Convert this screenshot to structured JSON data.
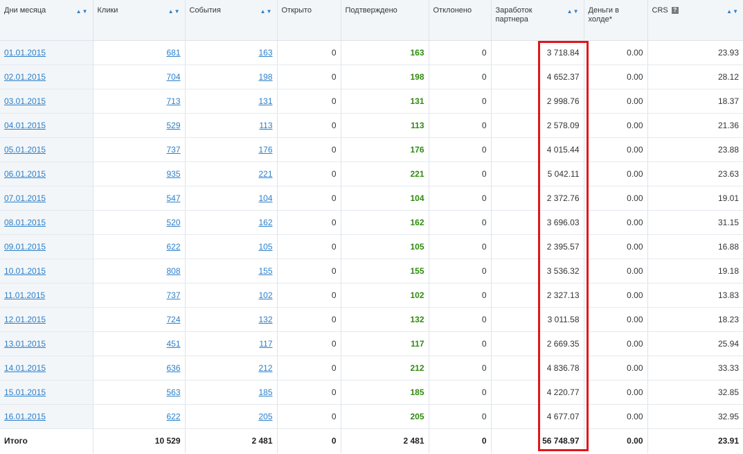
{
  "columns": [
    {
      "label": "Дни месяца",
      "sortable": true
    },
    {
      "label": "Клики",
      "sortable": true
    },
    {
      "label": "События",
      "sortable": true
    },
    {
      "label": "Открыто",
      "sortable": false
    },
    {
      "label": "Подтверждено",
      "sortable": false
    },
    {
      "label": "Отклонено",
      "sortable": false
    },
    {
      "label": "Заработок партнера",
      "sortable": true
    },
    {
      "label": "Деньги в холде*",
      "sortable": false
    },
    {
      "label": "CRS",
      "sortable": true,
      "help": "?"
    }
  ],
  "sort_glyph": "▲▼",
  "rows": [
    {
      "date": "01.01.2015",
      "clicks": "681",
      "events": "163",
      "open": "0",
      "confirmed": "163",
      "rejected": "0",
      "earnings": "3 718.84",
      "hold": "0.00",
      "crs": "23.93"
    },
    {
      "date": "02.01.2015",
      "clicks": "704",
      "events": "198",
      "open": "0",
      "confirmed": "198",
      "rejected": "0",
      "earnings": "4 652.37",
      "hold": "0.00",
      "crs": "28.12"
    },
    {
      "date": "03.01.2015",
      "clicks": "713",
      "events": "131",
      "open": "0",
      "confirmed": "131",
      "rejected": "0",
      "earnings": "2 998.76",
      "hold": "0.00",
      "crs": "18.37"
    },
    {
      "date": "04.01.2015",
      "clicks": "529",
      "events": "113",
      "open": "0",
      "confirmed": "113",
      "rejected": "0",
      "earnings": "2 578.09",
      "hold": "0.00",
      "crs": "21.36"
    },
    {
      "date": "05.01.2015",
      "clicks": "737",
      "events": "176",
      "open": "0",
      "confirmed": "176",
      "rejected": "0",
      "earnings": "4 015.44",
      "hold": "0.00",
      "crs": "23.88"
    },
    {
      "date": "06.01.2015",
      "clicks": "935",
      "events": "221",
      "open": "0",
      "confirmed": "221",
      "rejected": "0",
      "earnings": "5 042.11",
      "hold": "0.00",
      "crs": "23.63"
    },
    {
      "date": "07.01.2015",
      "clicks": "547",
      "events": "104",
      "open": "0",
      "confirmed": "104",
      "rejected": "0",
      "earnings": "2 372.76",
      "hold": "0.00",
      "crs": "19.01"
    },
    {
      "date": "08.01.2015",
      "clicks": "520",
      "events": "162",
      "open": "0",
      "confirmed": "162",
      "rejected": "0",
      "earnings": "3 696.03",
      "hold": "0.00",
      "crs": "31.15"
    },
    {
      "date": "09.01.2015",
      "clicks": "622",
      "events": "105",
      "open": "0",
      "confirmed": "105",
      "rejected": "0",
      "earnings": "2 395.57",
      "hold": "0.00",
      "crs": "16.88"
    },
    {
      "date": "10.01.2015",
      "clicks": "808",
      "events": "155",
      "open": "0",
      "confirmed": "155",
      "rejected": "0",
      "earnings": "3 536.32",
      "hold": "0.00",
      "crs": "19.18"
    },
    {
      "date": "11.01.2015",
      "clicks": "737",
      "events": "102",
      "open": "0",
      "confirmed": "102",
      "rejected": "0",
      "earnings": "2 327.13",
      "hold": "0.00",
      "crs": "13.83"
    },
    {
      "date": "12.01.2015",
      "clicks": "724",
      "events": "132",
      "open": "0",
      "confirmed": "132",
      "rejected": "0",
      "earnings": "3 011.58",
      "hold": "0.00",
      "crs": "18.23"
    },
    {
      "date": "13.01.2015",
      "clicks": "451",
      "events": "117",
      "open": "0",
      "confirmed": "117",
      "rejected": "0",
      "earnings": "2 669.35",
      "hold": "0.00",
      "crs": "25.94"
    },
    {
      "date": "14.01.2015",
      "clicks": "636",
      "events": "212",
      "open": "0",
      "confirmed": "212",
      "rejected": "0",
      "earnings": "4 836.78",
      "hold": "0.00",
      "crs": "33.33"
    },
    {
      "date": "15.01.2015",
      "clicks": "563",
      "events": "185",
      "open": "0",
      "confirmed": "185",
      "rejected": "0",
      "earnings": "4 220.77",
      "hold": "0.00",
      "crs": "32.85"
    },
    {
      "date": "16.01.2015",
      "clicks": "622",
      "events": "205",
      "open": "0",
      "confirmed": "205",
      "rejected": "0",
      "earnings": "4 677.07",
      "hold": "0.00",
      "crs": "32.95"
    }
  ],
  "totals": {
    "label": "Итого",
    "clicks": "10 529",
    "events": "2 481",
    "open": "0",
    "confirmed": "2 481",
    "rejected": "0",
    "earnings": "56 748.97",
    "hold": "0.00",
    "crs": "23.91"
  },
  "colors": {
    "link": "#2a7fc9",
    "confirmed": "#2f8a10",
    "highlight": "#e3151a",
    "header_bg": "#f3f6f9"
  }
}
